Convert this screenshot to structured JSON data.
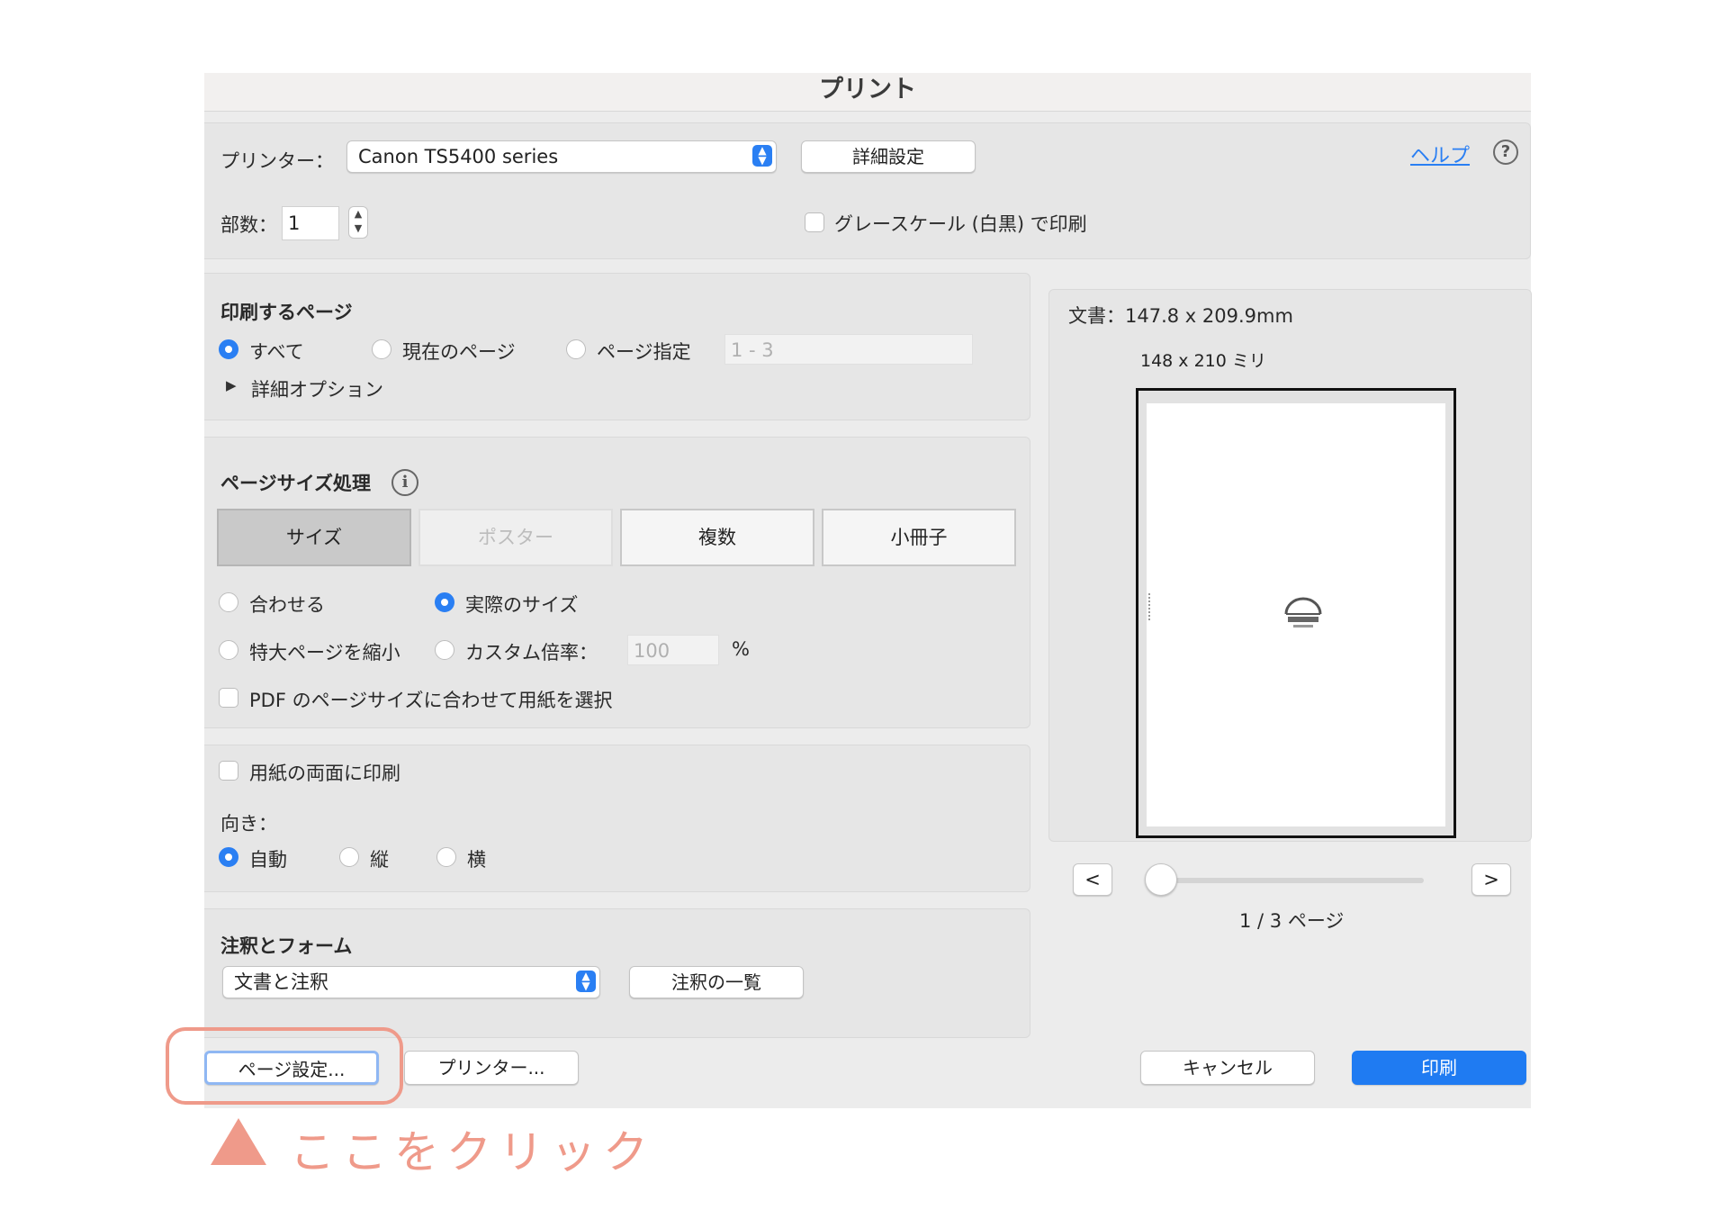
{
  "dialog": {
    "title": "プリント",
    "printer_label": "プリンター：",
    "printer_value": "Canon TS5400 series",
    "advanced_button": "詳細設定",
    "help_link": "ヘルプ",
    "help_icon": "?",
    "copies_label": "部数：",
    "copies_value": "1",
    "grayscale_label": "グレースケール (白黒) で印刷"
  },
  "pages_section": {
    "heading": "印刷するページ",
    "all": "すべて",
    "current": "現在のページ",
    "range": "ページ指定",
    "range_value": "1 - 3",
    "more_options": "詳細オプション",
    "more_options_arrow": "▶"
  },
  "page_size_section": {
    "heading": "ページサイズ処理",
    "info_icon": "i",
    "tabs": [
      "サイズ",
      "ポスター",
      "複数",
      "小冊子"
    ],
    "fit": "合わせる",
    "actual_size": "実際のサイズ",
    "shrink": "特大ページを縮小",
    "custom_scale": "カスタム倍率：",
    "scale_value": "100",
    "percent": "%",
    "pdf_paper": "PDF のページサイズに合わせて用紙を選択"
  },
  "duplex_section": {
    "duplex": "用紙の両面に印刷",
    "orientation_label": "向き：",
    "auto": "自動",
    "portrait": "縦",
    "landscape": "横"
  },
  "comments_section": {
    "heading": "注釈とフォーム",
    "select_value": "文書と注釈",
    "summarize_button": "注釈の一覧"
  },
  "preview": {
    "doc_size": "文書：147.8 x 209.9mm",
    "paper_size": "148 x 210 ミリ",
    "prev_button": "<",
    "next_button": ">",
    "page_indicator": "1 / 3 ページ"
  },
  "footer": {
    "page_setup": "ページ設定...",
    "printer_button": "プリンター...",
    "cancel": "キャンセル",
    "print": "印刷"
  },
  "annotation": {
    "text": "ここをクリック",
    "color": "#ef9a8a"
  },
  "colors": {
    "accent": "#2a7ff3",
    "annotation": "#ef9a8a"
  }
}
